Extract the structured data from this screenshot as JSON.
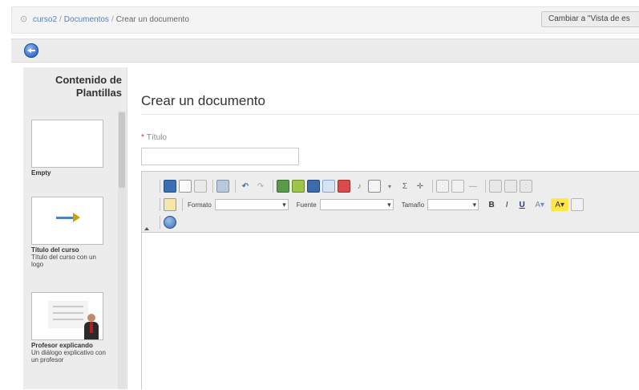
{
  "breadcrumb": {
    "items": [
      "curso2",
      "Documentos",
      "Crear un documento"
    ],
    "separator": "/"
  },
  "view_button_label": "Cambiar a \"Vista de es",
  "templates_panel": {
    "title": "Contenido de Plantillas",
    "templates": [
      {
        "name": "Empty",
        "description": ""
      },
      {
        "name": "Título del curso",
        "description": "Título del curso con un logo"
      },
      {
        "name": "Profesor explicando",
        "description": "Un diálogo explicativo con un profesor"
      }
    ]
  },
  "main": {
    "title": "Crear un documento",
    "title_field": {
      "label": "Título",
      "required_mark": "*",
      "value": ""
    }
  },
  "editor": {
    "toolbar": {
      "format_label": "Formato",
      "font_label": "Fuente",
      "size_label": "Tamaño",
      "bold_label": "B",
      "italic_label": "I",
      "underline_label": "U"
    },
    "content": ""
  },
  "colors": {
    "link": "#5a7fb5",
    "back_icon": "#2f6bc7",
    "panel_bg": "#ececec",
    "required": "#cc3333"
  }
}
